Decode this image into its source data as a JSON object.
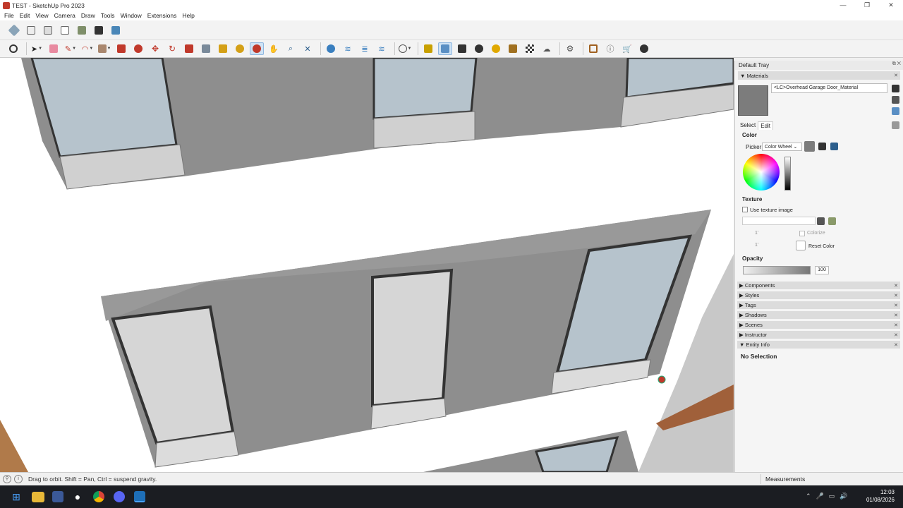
{
  "window": {
    "title": "TEST - SketchUp Pro 2023",
    "controls": [
      "—",
      "❐",
      "✕"
    ]
  },
  "menu": [
    "File",
    "Edit",
    "View",
    "Camera",
    "Draw",
    "Tools",
    "Window",
    "Extensions",
    "Help"
  ],
  "tray": {
    "title": "Default Tray",
    "materials": {
      "header": "Materials",
      "material_name": "<LC>Overhead Garage Door_Material",
      "tabs": [
        "Select",
        "Edit"
      ],
      "color_label": "Color",
      "picker_label": "Picker:",
      "picker_value": "Color Wheel",
      "texture_label": "Texture",
      "use_texture": "Use texture image",
      "dim_w": "1'",
      "dim_h": "1'",
      "colorize": "Colorize",
      "reset_color": "Reset Color",
      "opacity_label": "Opacity",
      "opacity_value": "100"
    },
    "panels": [
      "Components",
      "Styles",
      "Tags",
      "Shadows",
      "Scenes",
      "Instructor",
      "Entity Info"
    ],
    "entity_info": "No Selection"
  },
  "status": {
    "message": "Drag to orbit. Shift = Pan, Ctrl = suspend gravity.",
    "measurements": "Measurements"
  },
  "clock": {
    "time": "12:03",
    "date": "01/08/2026"
  },
  "colors": {
    "accent": "#0078d4",
    "wall": "#8e8e8e",
    "glass": "#b6c3cc"
  }
}
